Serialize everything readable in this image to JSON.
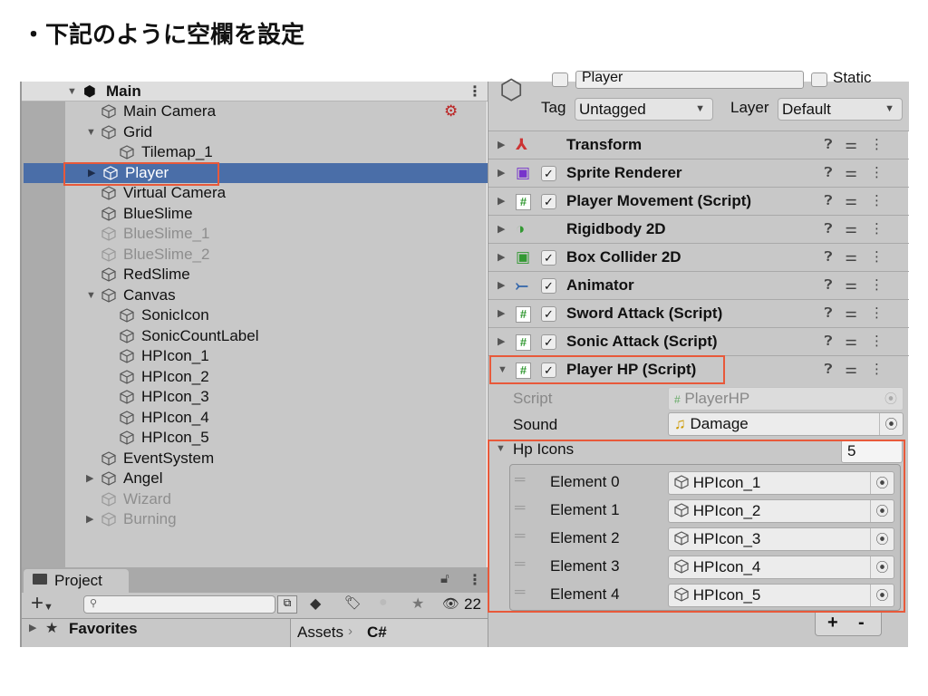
{
  "title": "・下記のように空欄を設定",
  "hierarchy": {
    "scene": "Main",
    "items": [
      {
        "label": "Main Camera",
        "level": 1,
        "arrow": "",
        "dim": false
      },
      {
        "label": "Grid",
        "level": 1,
        "arrow": "▼",
        "dim": false
      },
      {
        "label": "Tilemap_1",
        "level": 2,
        "arrow": "",
        "dim": false
      },
      {
        "label": "Player",
        "level": 1,
        "arrow": "▶",
        "dim": false,
        "selected": true
      },
      {
        "label": "Virtual Camera",
        "level": 1,
        "arrow": "",
        "dim": false
      },
      {
        "label": "BlueSlime",
        "level": 1,
        "arrow": "",
        "dim": false
      },
      {
        "label": "BlueSlime_1",
        "level": 1,
        "arrow": "",
        "dim": true
      },
      {
        "label": "BlueSlime_2",
        "level": 1,
        "arrow": "",
        "dim": true
      },
      {
        "label": "RedSlime",
        "level": 1,
        "arrow": "",
        "dim": false
      },
      {
        "label": "Canvas",
        "level": 1,
        "arrow": "▼",
        "dim": false
      },
      {
        "label": "SonicIcon",
        "level": 2,
        "arrow": "",
        "dim": false
      },
      {
        "label": "SonicCountLabel",
        "level": 2,
        "arrow": "",
        "dim": false
      },
      {
        "label": "HPIcon_1",
        "level": 2,
        "arrow": "",
        "dim": false
      },
      {
        "label": "HPIcon_2",
        "level": 2,
        "arrow": "",
        "dim": false
      },
      {
        "label": "HPIcon_3",
        "level": 2,
        "arrow": "",
        "dim": false
      },
      {
        "label": "HPIcon_4",
        "level": 2,
        "arrow": "",
        "dim": false
      },
      {
        "label": "HPIcon_5",
        "level": 2,
        "arrow": "",
        "dim": false
      },
      {
        "label": "EventSystem",
        "level": 1,
        "arrow": "",
        "dim": false
      },
      {
        "label": "Angel",
        "level": 1,
        "arrow": "▶",
        "dim": false
      },
      {
        "label": "Wizard",
        "level": 1,
        "arrow": "",
        "dim": true
      },
      {
        "label": "Burning",
        "level": 1,
        "arrow": "▶",
        "dim": true
      }
    ]
  },
  "project": {
    "tab": "Project",
    "hidden_count": "22",
    "favorites": "Favorites",
    "breadcrumb": [
      "Assets",
      "C#"
    ],
    "search_placeholder": ""
  },
  "inspector": {
    "name": "Player",
    "static": "Static",
    "tag_label": "Tag",
    "tag": "Untagged",
    "layer_label": "Layer",
    "layer": "Default",
    "components": [
      {
        "name": "Transform",
        "icon": "transform-icon",
        "checkbox": false
      },
      {
        "name": "Sprite Renderer",
        "icon": "sprite-renderer-icon",
        "checkbox": true
      },
      {
        "name": "Player Movement (Script)",
        "icon": "script-icon",
        "checkbox": true
      },
      {
        "name": "Rigidbody 2D",
        "icon": "rigidbody-icon",
        "checkbox": false
      },
      {
        "name": "Box Collider 2D",
        "icon": "box-collider-icon",
        "checkbox": true
      },
      {
        "name": "Animator",
        "icon": "animator-icon",
        "checkbox": true
      },
      {
        "name": "Sword Attack (Script)",
        "icon": "script-icon",
        "checkbox": true
      },
      {
        "name": "Sonic Attack (Script)",
        "icon": "script-icon",
        "checkbox": true
      },
      {
        "name": "Player HP (Script)",
        "icon": "script-icon",
        "checkbox": true,
        "expanded": true
      }
    ],
    "script_label": "Script",
    "script_value": "PlayerHP",
    "sound_label": "Sound",
    "sound_value": "Damage",
    "hp_icons_label": "Hp Icons",
    "hp_icons_size": "5",
    "elements": [
      {
        "label": "Element 0",
        "value": "HPIcon_1"
      },
      {
        "label": "Element 1",
        "value": "HPIcon_2"
      },
      {
        "label": "Element 2",
        "value": "HPIcon_3"
      },
      {
        "label": "Element 3",
        "value": "HPIcon_4"
      },
      {
        "label": "Element 4",
        "value": "HPIcon_5"
      }
    ],
    "plus": "+",
    "minus": "-"
  },
  "colors": {
    "highlight": "#e8593a",
    "selection": "#4a6ea8"
  }
}
